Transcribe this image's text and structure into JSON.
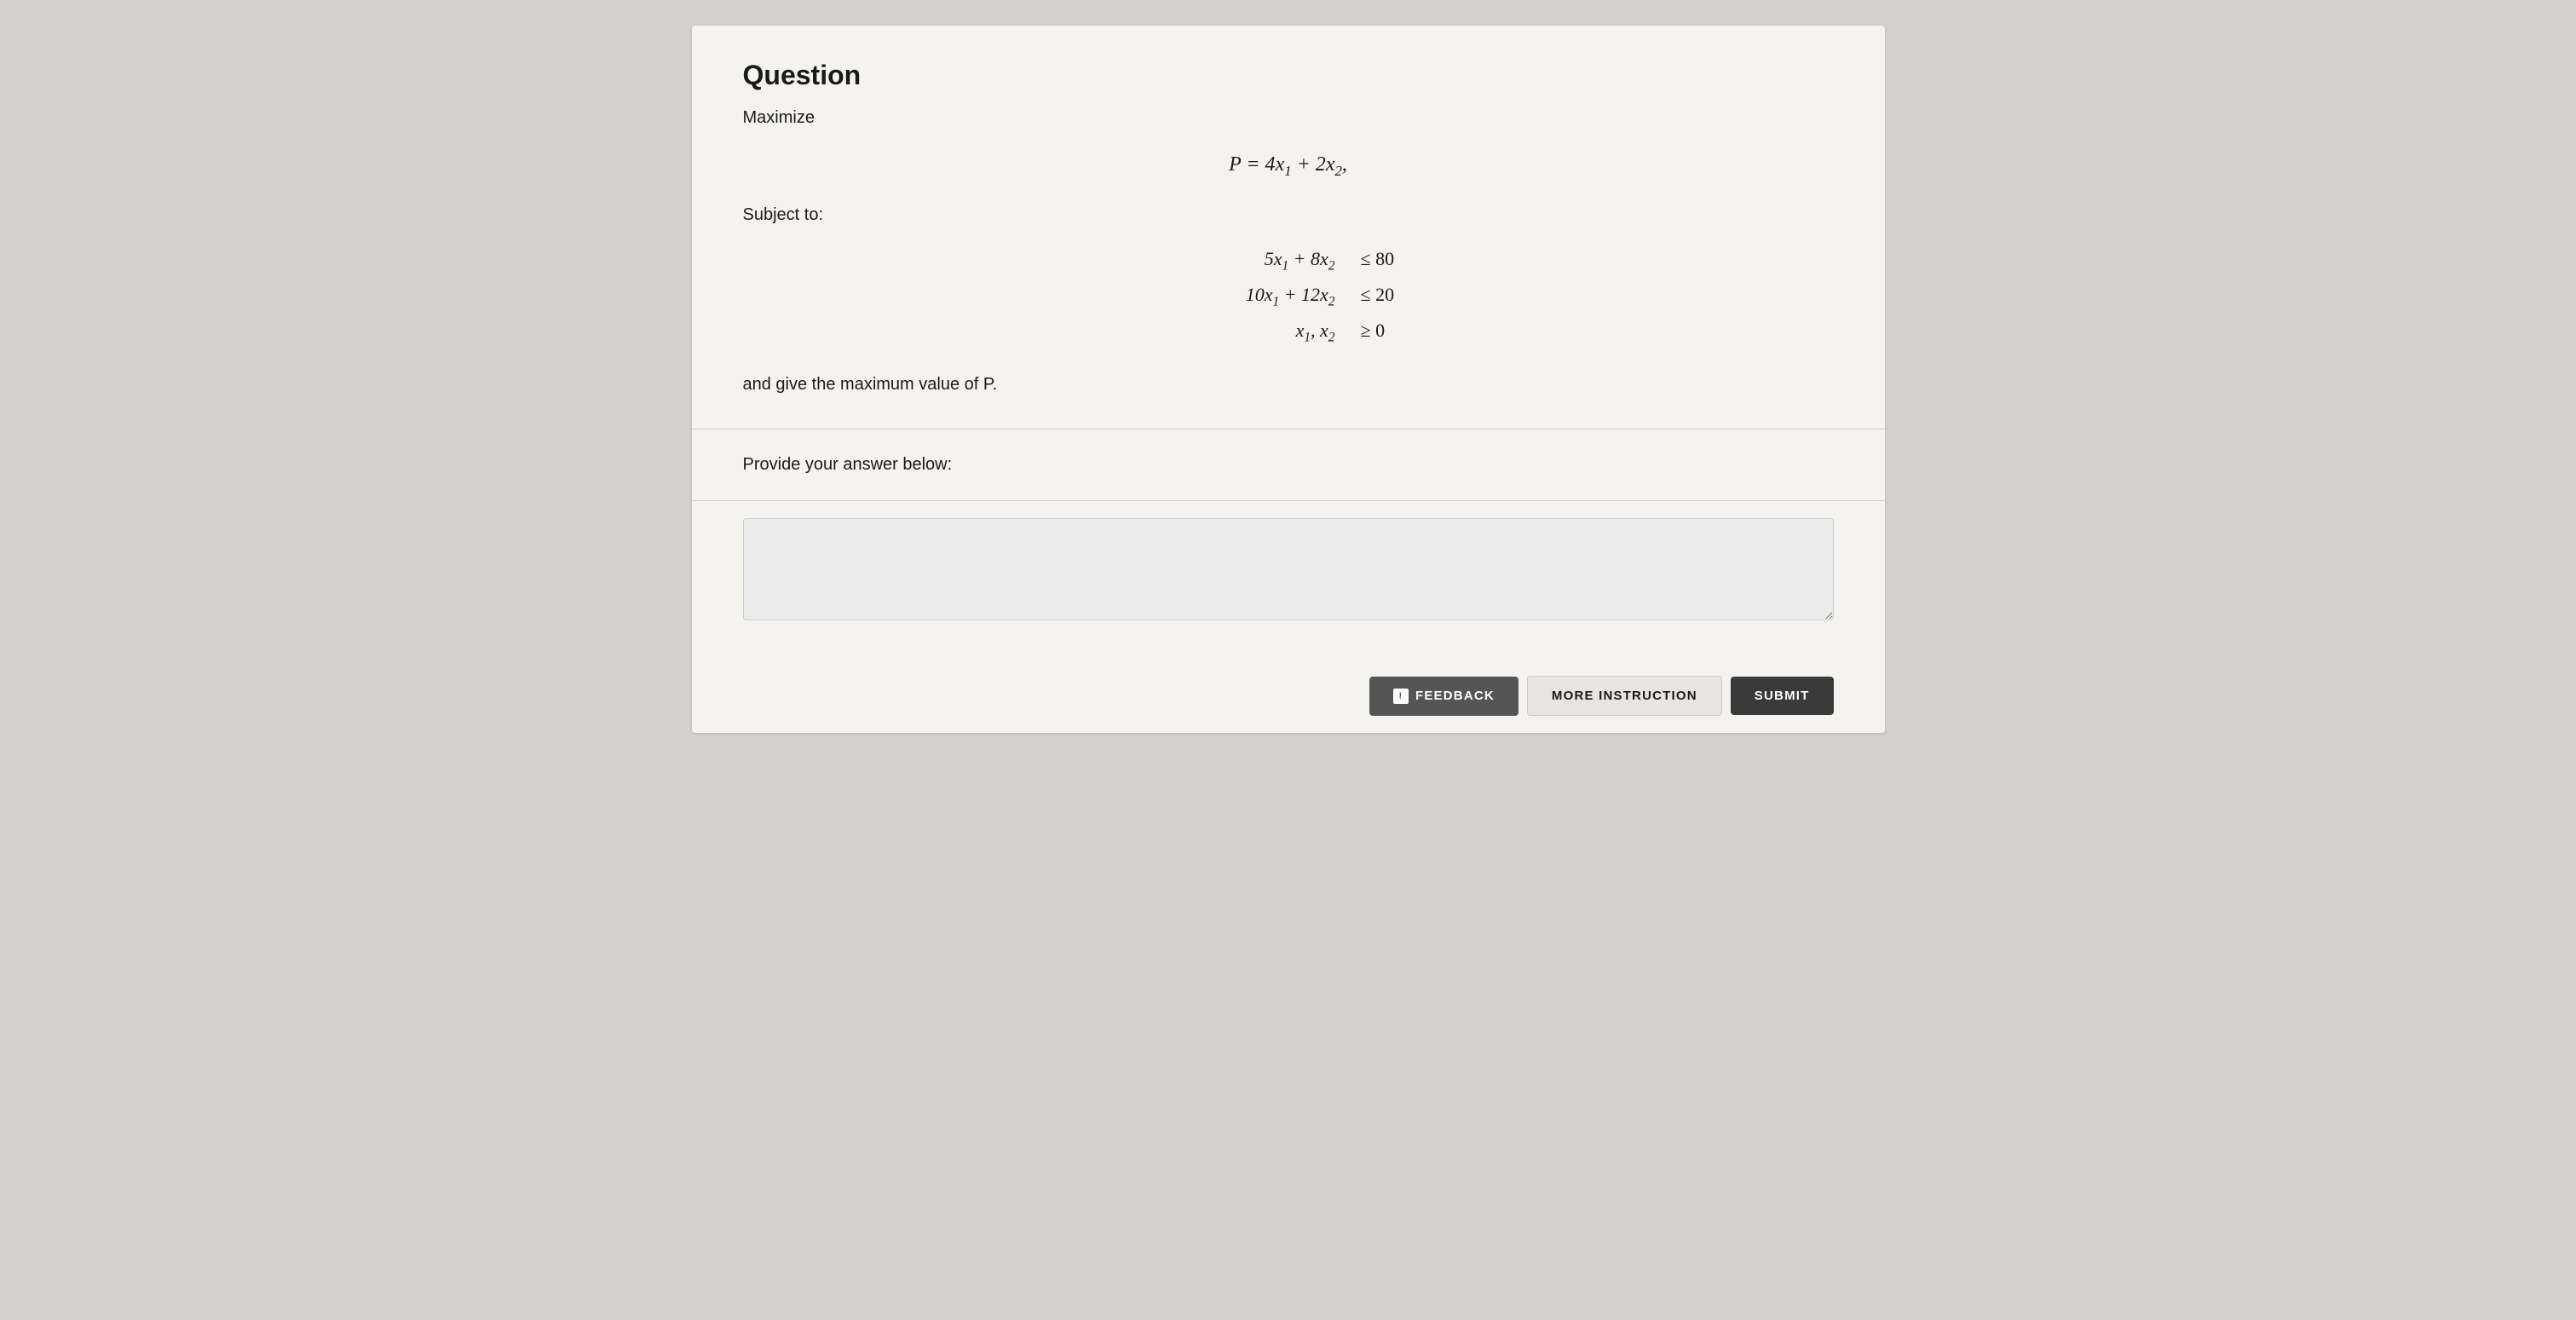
{
  "page": {
    "background_color": "#d4d0cc"
  },
  "question": {
    "title": "Question",
    "maximize_label": "Maximize",
    "objective_function": "P = 4x₁ + 2x₂,",
    "subject_to_label": "Subject to:",
    "constraints": [
      {
        "lhs": "5x₁ + 8x₂",
        "rel": "≤ 80"
      },
      {
        "lhs": "10x₁ + 12x₂",
        "rel": "≤ 20"
      },
      {
        "lhs": "x₁, x₂",
        "rel": "≥ 0"
      }
    ],
    "and_give": "and give the maximum value of P.",
    "provide_answer": "Provide your answer below:"
  },
  "buttons": {
    "feedback_label": "FEEDBACK",
    "feedback_icon": "!",
    "more_instruction_label": "MORE INSTRUCTION",
    "submit_label": "SUBMIT"
  }
}
